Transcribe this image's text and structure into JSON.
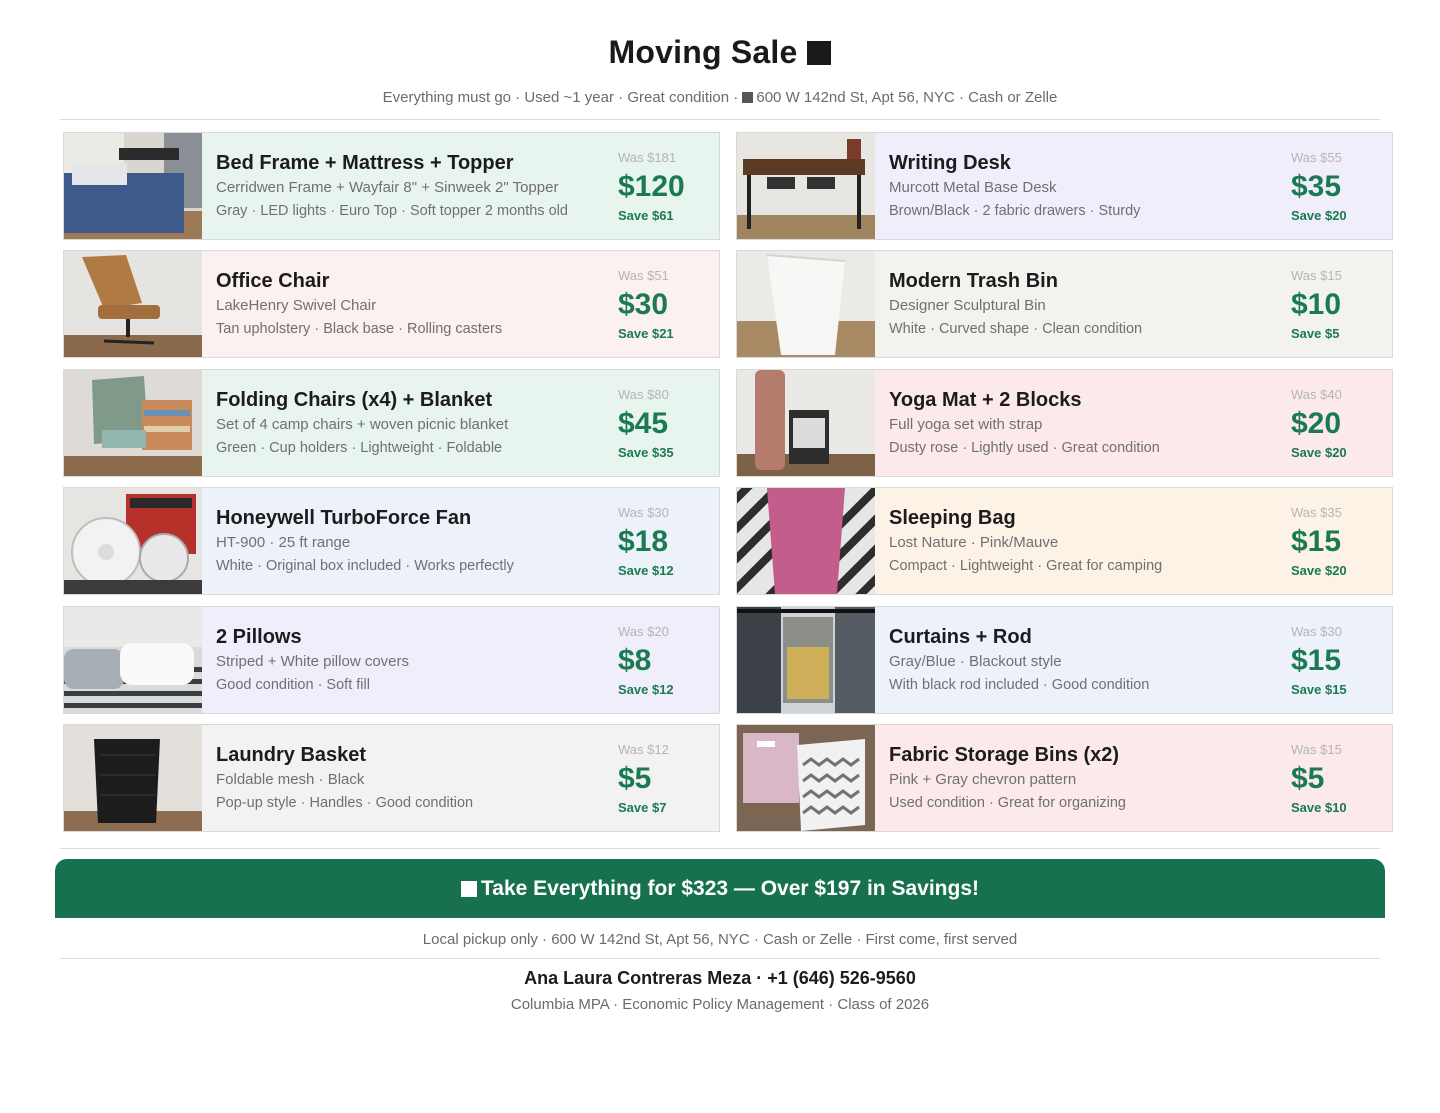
{
  "header": {
    "title": "Moving Sale",
    "subtitle_left": "Everything must go · Used ~1 year · Great condition · ",
    "subtitle_right": "600 W 142nd St, Apt 56, NYC · Cash or Zelle"
  },
  "items": [
    {
      "name": "Bed Frame + Mattress + Topper",
      "sub": "Cerridwen Frame + Wayfair 8\" + Sinweek 2\" Topper",
      "detail": "Gray · LED lights · Euro Top · Soft topper 2 months old",
      "was": "Was $181",
      "price": "$120",
      "save": "Save $61",
      "bg": "#e8f4ee",
      "photo": "bed-photo"
    },
    {
      "name": "Writing Desk",
      "sub": "Murcott Metal Base Desk",
      "detail": "Brown/Black · 2 fabric drawers · Sturdy",
      "was": "Was $55",
      "price": "$35",
      "save": "Save $20",
      "bg": "#f1eefb",
      "photo": "desk-photo"
    },
    {
      "name": "Office Chair",
      "sub": "LakeHenry Swivel Chair",
      "detail": "Tan upholstery · Black base · Rolling casters",
      "was": "Was $51",
      "price": "$30",
      "save": "Save $21",
      "bg": "#fbf1ee",
      "photo": "chair-photo"
    },
    {
      "name": "Modern Trash Bin",
      "sub": "Designer Sculptural Bin",
      "detail": "White · Curved shape · Clean condition",
      "was": "Was $15",
      "price": "$10",
      "save": "Save $5",
      "bg": "#f2f2ef",
      "photo": "trash-bin-photo"
    },
    {
      "name": "Folding Chairs (x4) + Blanket",
      "sub": "Set of 4 camp chairs + woven picnic blanket",
      "detail": "Green · Cup holders · Lightweight · Foldable",
      "was": "Was $80",
      "price": "$45",
      "save": "Save $35",
      "bg": "#e8f4ee",
      "photo": "folding-chair-photo"
    },
    {
      "name": "Yoga Mat + 2 Blocks",
      "sub": "Full yoga set with strap",
      "detail": "Dusty rose · Lightly used · Great condition",
      "was": "Was $40",
      "price": "$20",
      "save": "Save $20",
      "bg": "#fbe9ec",
      "photo": "yoga-mat-photo"
    },
    {
      "name": "Honeywell TurboForce Fan",
      "sub": "HT-900 · 25 ft range",
      "detail": "White · Original box included · Works perfectly",
      "was": "Was $30",
      "price": "$18",
      "save": "Save $12",
      "bg": "#ecf1fa",
      "photo": "fan-photo"
    },
    {
      "name": "Sleeping Bag",
      "sub": "Lost Nature · Pink/Mauve",
      "detail": "Compact · Lightweight · Great for camping",
      "was": "Was $35",
      "price": "$15",
      "save": "Save $20",
      "bg": "#fcf3e6",
      "photo": "sleeping-bag-photo"
    },
    {
      "name": "2 Pillows",
      "sub": "Striped + White pillow covers",
      "detail": "Good condition · Soft fill",
      "was": "Was $20",
      "price": "$8",
      "save": "Save $12",
      "bg": "#f1eefb",
      "photo": "pillows-photo"
    },
    {
      "name": "Curtains + Rod",
      "sub": "Gray/Blue · Blackout style",
      "detail": "With black rod included · Good condition",
      "was": "Was $30",
      "price": "$15",
      "save": "Save $15",
      "bg": "#ecf1fa",
      "photo": "curtains-photo"
    },
    {
      "name": "Laundry Basket",
      "sub": "Foldable mesh · Black",
      "detail": "Pop-up style · Handles · Good condition",
      "was": "Was $12",
      "price": "$5",
      "save": "Save $7",
      "bg": "#f2f2f2",
      "photo": "laundry-basket-photo"
    },
    {
      "name": "Fabric Storage Bins (x2)",
      "sub": "Pink + Gray chevron pattern",
      "detail": "Used condition · Great for organizing",
      "was": "Was $15",
      "price": "$5",
      "save": "Save $10",
      "bg": "#fbe9ec",
      "photo": "storage-bins-photo"
    }
  ],
  "banner": {
    "text": "Take Everything for $323 — Over $197 in Savings!"
  },
  "footer": {
    "pickup": "Local pickup only · 600 W 142nd St, Apt 56, NYC · Cash or Zelle · First come, first served",
    "contact": "Ana Laura Contreras Meza · +1 (646) 526-9560",
    "school": "Columbia MPA · Economic Policy Management · Class of 2026"
  },
  "colors": {
    "accent_green": "#1c7a52",
    "banner_green": "#17714f"
  }
}
